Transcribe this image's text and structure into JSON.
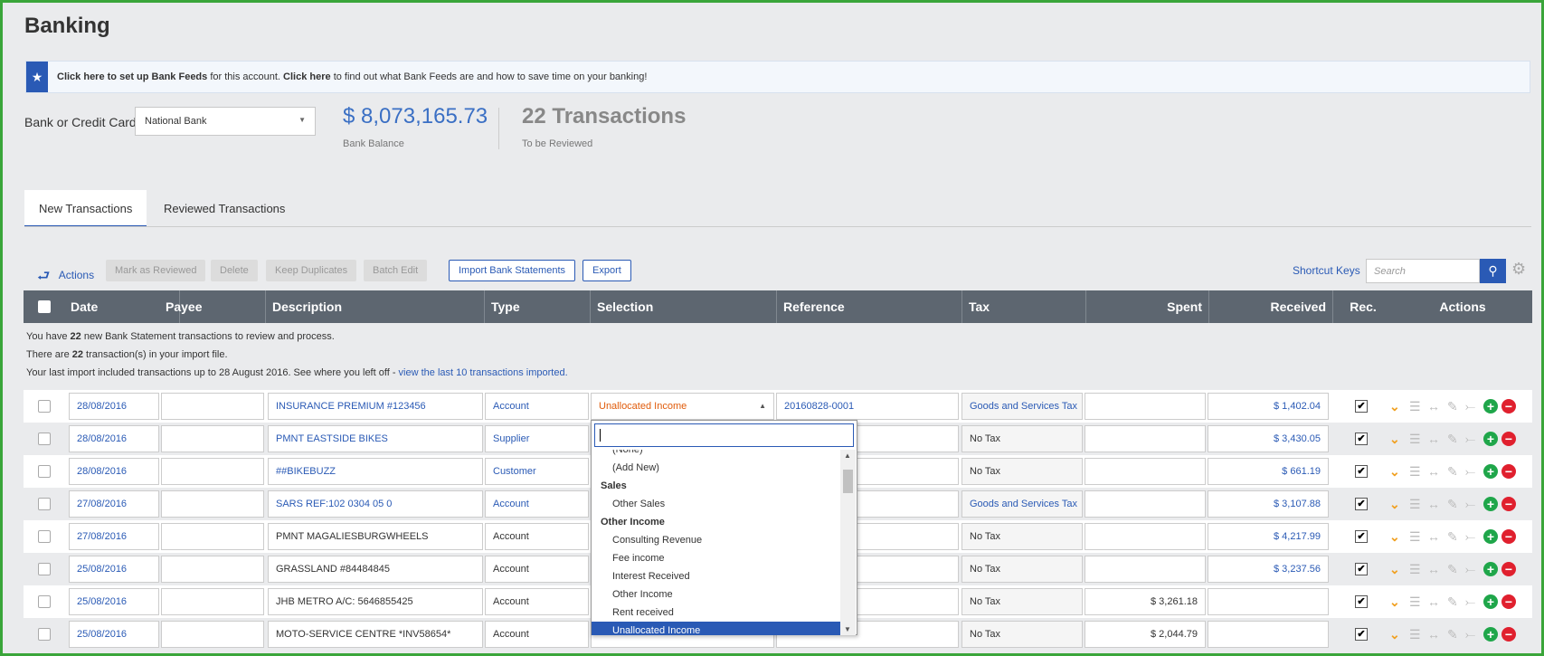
{
  "page": {
    "title": "Banking"
  },
  "banner": {
    "link1": "Click here to set up Bank Feeds",
    "text1": " for this account. ",
    "link2": "Click here",
    "text2": " to find out what Bank Feeds are and how to save time on your banking!"
  },
  "account": {
    "label": "Bank or Credit Card",
    "selected": "National Bank",
    "balance": "$ 8,073,165.73",
    "balance_label": "Bank Balance",
    "transactions": "22 Transactions",
    "transactions_label": "To be Reviewed"
  },
  "tabs": [
    {
      "label": "New Transactions",
      "active": true
    },
    {
      "label": "Reviewed Transactions",
      "active": false
    }
  ],
  "toolbar": {
    "actions": "Actions",
    "mark_reviewed": "Mark as Reviewed",
    "delete": "Delete",
    "keep_duplicates": "Keep Duplicates",
    "batch_edit": "Batch Edit",
    "import": "Import Bank Statements",
    "export": "Export",
    "shortcut_keys": "Shortcut Keys",
    "search_placeholder": "Search"
  },
  "columns": [
    "Date",
    "Payee",
    "Description",
    "Type",
    "Selection",
    "Reference",
    "Tax",
    "Spent",
    "Received",
    "Rec.",
    "Actions"
  ],
  "info": {
    "line1_pre": "You have ",
    "line1_count": "22",
    "line1_post": " new Bank Statement transactions to review and process.",
    "line2_pre": "There are ",
    "line2_count": "22",
    "line2_post": " transaction(s) in your import file.",
    "line3_pre": "Your last import included transactions up to 28 August 2016. See where you left off - ",
    "line3_link": "view the last 10 transactions imported."
  },
  "rows": [
    {
      "date": "28/08/2016",
      "payee": "",
      "description": "INSURANCE PREMIUM #123456",
      "type": "Account",
      "selection": "Unallocated Income",
      "reference": "20160828-0001",
      "tax": "Goods and Services Tax",
      "spent": "",
      "received": "$ 1,402.04"
    },
    {
      "date": "28/08/2016",
      "payee": "",
      "description": "PMNT EASTSIDE BIKES",
      "type": "Supplier",
      "selection": "",
      "reference": "",
      "tax": "No Tax",
      "spent": "",
      "received": "$ 3,430.05"
    },
    {
      "date": "28/08/2016",
      "payee": "",
      "description": "##BIKEBUZZ",
      "type": "Customer",
      "selection": "",
      "reference": "",
      "tax": "No Tax",
      "spent": "",
      "received": "$ 661.19"
    },
    {
      "date": "27/08/2016",
      "payee": "",
      "description": "SARS REF:102 0304 05 0",
      "type": "Account",
      "selection": "",
      "reference": "",
      "tax": "Goods and Services Tax",
      "spent": "",
      "received": "$ 3,107.88"
    },
    {
      "date": "27/08/2016",
      "payee": "",
      "description": "PMNT MAGALIESBURGWHEELS",
      "type": "Account",
      "selection": "",
      "reference": "",
      "tax": "No Tax",
      "spent": "",
      "received": "$ 4,217.99"
    },
    {
      "date": "25/08/2016",
      "payee": "",
      "description": "GRASSLAND #84484845",
      "type": "Account",
      "selection": "",
      "reference": "",
      "tax": "No Tax",
      "spent": "",
      "received": "$ 3,237.56"
    },
    {
      "date": "25/08/2016",
      "payee": "",
      "description": "JHB METRO A/C: 5646855425",
      "type": "Account",
      "selection": "",
      "reference": "",
      "tax": "No Tax",
      "spent": "$ 3,261.18",
      "received": ""
    },
    {
      "date": "25/08/2016",
      "payee": "",
      "description": "MOTO-SERVICE CENTRE *INV58654*",
      "type": "Account",
      "selection": "",
      "reference": "",
      "tax": "No Tax",
      "spent": "$ 2,044.79",
      "received": ""
    }
  ],
  "dropdown": {
    "items": [
      {
        "label": "(None)",
        "kind": "item"
      },
      {
        "label": "(Add New)",
        "kind": "item"
      },
      {
        "label": "Sales",
        "kind": "group"
      },
      {
        "label": "Other Sales",
        "kind": "item"
      },
      {
        "label": "Other Income",
        "kind": "group"
      },
      {
        "label": "Consulting Revenue",
        "kind": "item"
      },
      {
        "label": "Fee income",
        "kind": "item"
      },
      {
        "label": "Interest Received",
        "kind": "item"
      },
      {
        "label": "Other Income",
        "kind": "item"
      },
      {
        "label": "Rent received",
        "kind": "item"
      },
      {
        "label": "Unallocated Income",
        "kind": "selected"
      }
    ]
  },
  "colors": {
    "accent": "#2a5ab5",
    "header_bg": "#5d6670",
    "orange": "#e05b0a",
    "green": "#1fa64a",
    "red": "#e0202e"
  }
}
